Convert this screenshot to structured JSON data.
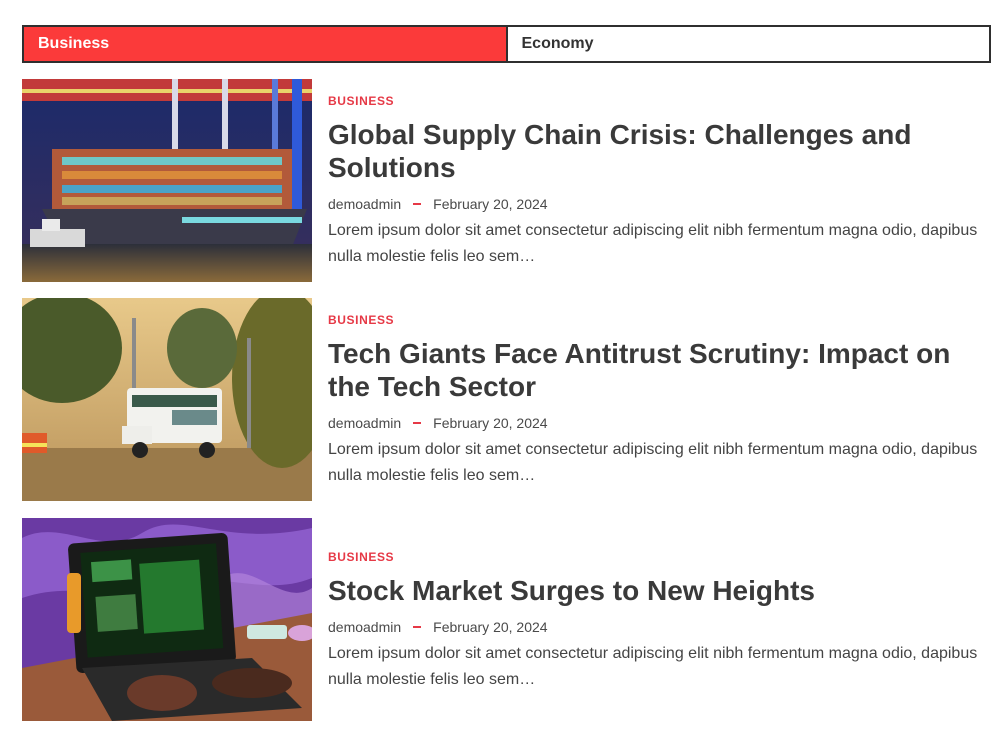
{
  "tabs": [
    {
      "label": "Business",
      "active": true
    },
    {
      "label": "Economy",
      "active": false
    }
  ],
  "posts": [
    {
      "category": "BUSINESS",
      "title": "Global Supply Chain Crisis: Challenges and Solutions",
      "author": "demoadmin",
      "date": "February 20, 2024",
      "excerpt": "Lorem ipsum dolor sit amet consectetur adipiscing elit nibh fermentum magna odio, dapibus nulla molestie felis leo sem…"
    },
    {
      "category": "BUSINESS",
      "title": "Tech Giants Face Antitrust Scrutiny: Impact on the Tech Sector",
      "author": "demoadmin",
      "date": "February 20, 2024",
      "excerpt": "Lorem ipsum dolor sit amet consectetur adipiscing elit nibh fermentum magna odio, dapibus nulla molestie felis leo sem…"
    },
    {
      "category": "BUSINESS",
      "title": "Stock Market Surges to New Heights",
      "author": "demoadmin",
      "date": "February 20, 2024",
      "excerpt": "Lorem ipsum dolor sit amet consectetur adipiscing elit nibh fermentum magna odio, dapibus nulla molestie felis leo sem…"
    }
  ],
  "colors": {
    "accent": "#fb3a3a",
    "category": "#e63946",
    "title": "#3a3a3a"
  }
}
